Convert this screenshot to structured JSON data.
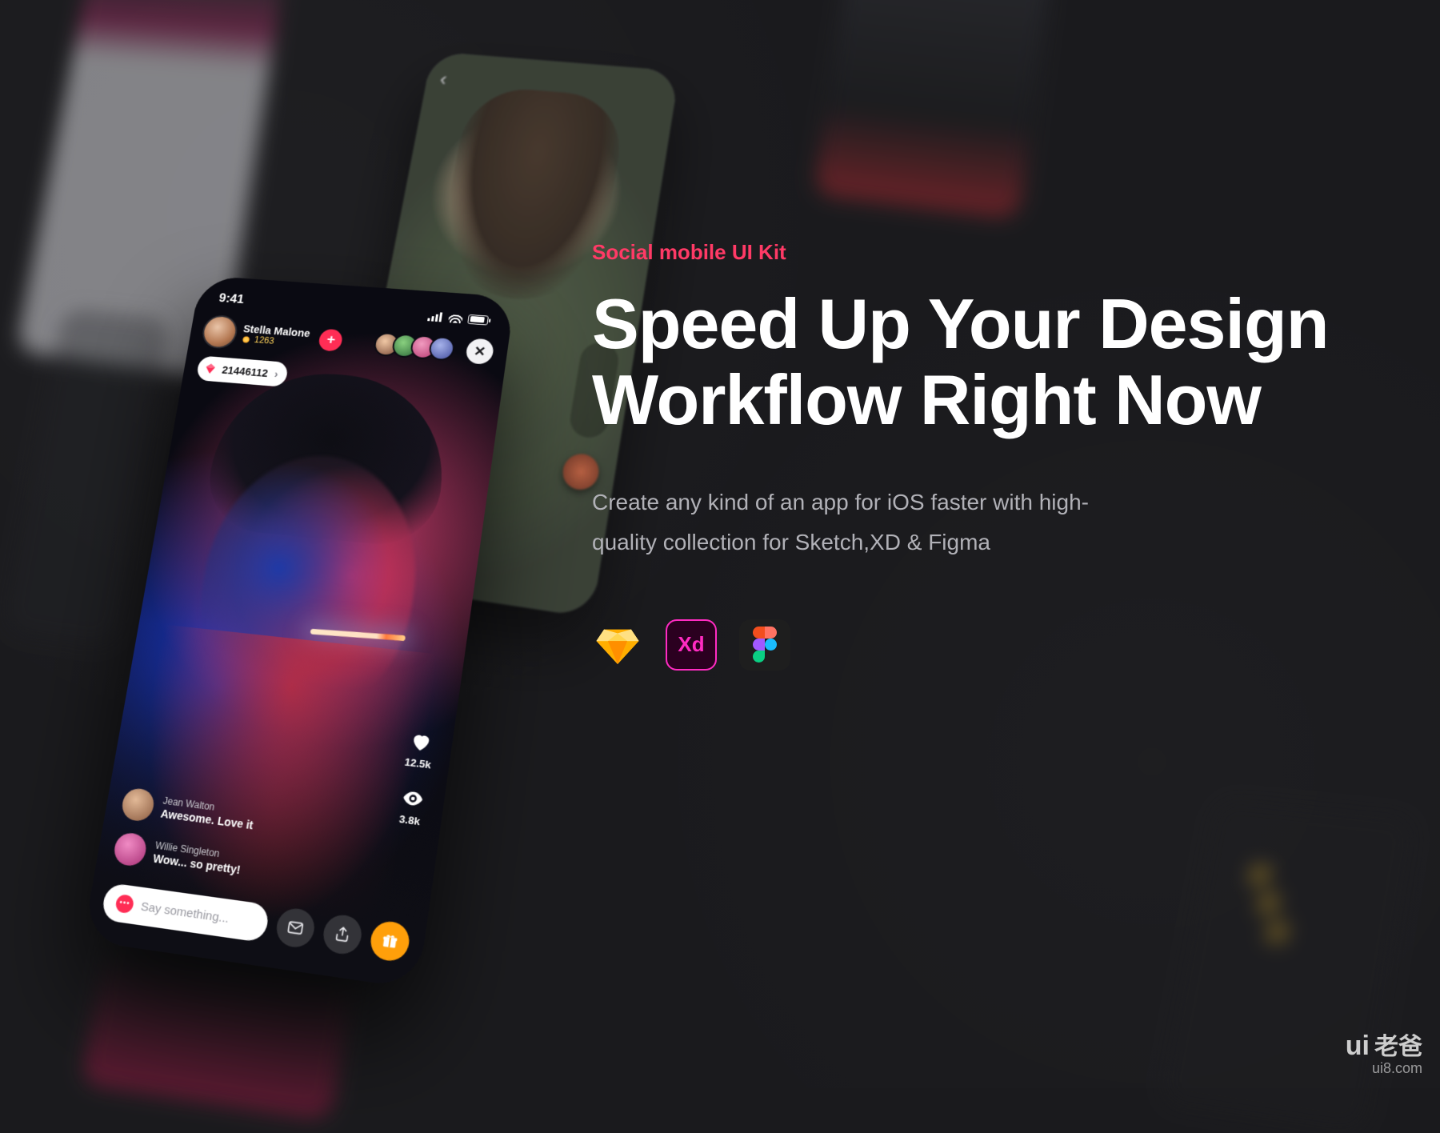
{
  "marketing": {
    "eyebrow": "Social mobile UI Kit",
    "headline": "Speed Up Your Design Workflow Right Now",
    "subcopy": "Create any kind of an app for iOS faster with high-quality collection for Sketch,XD & Figma",
    "tools": {
      "sketch": "Sketch",
      "xd": "Xd",
      "figma": "Figma"
    }
  },
  "phone": {
    "status": {
      "time": "9:41"
    },
    "host": {
      "name": "Stella Malone",
      "coins": "1263"
    },
    "gem_count": "21446112",
    "stats": {
      "likes": "12.5k",
      "views": "3.8k"
    },
    "comments": [
      {
        "name": "Jean Walton",
        "msg": "Awesome. Love it"
      },
      {
        "name": "Willie Singleton",
        "msg": "Wow... so pretty!"
      }
    ],
    "input_placeholder": "Say something..."
  },
  "watermark": {
    "brand": "ui",
    "cn": "老爸",
    "site": "ui8.com"
  }
}
